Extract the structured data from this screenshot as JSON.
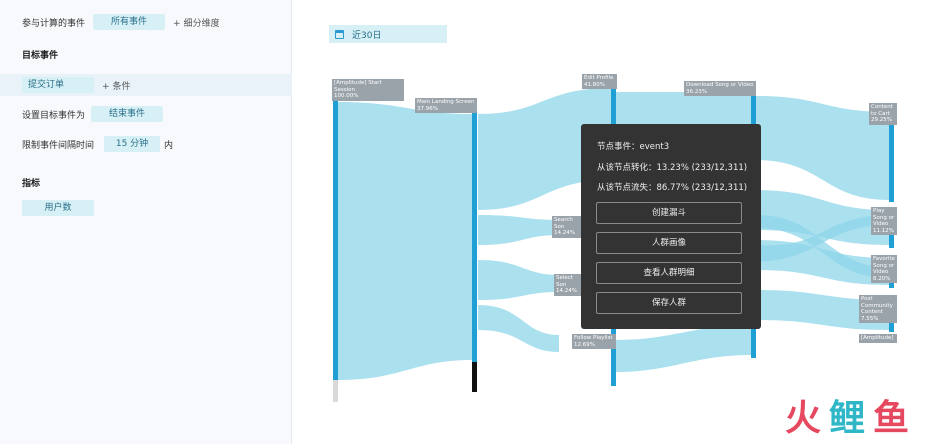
{
  "config": {
    "events_label": "参与计算的事件",
    "events_value": "所有事件",
    "add_dimension": "细分维度",
    "target_title": "目标事件",
    "target_event": "提交订单",
    "add_condition": "条件",
    "set_target_label": "设置目标事件为",
    "set_target_value": "结束事件",
    "interval_label": "限制事件间隔时间",
    "interval_value": "15 分钟",
    "interval_suffix": "内",
    "metric_title": "指标",
    "metric_value": "用户数"
  },
  "main": {
    "date_range": "近30日"
  },
  "nodes": [
    {
      "name": "[Amplitude] Start Session",
      "pct": "100.00%"
    },
    {
      "name": "Main Landing Screen",
      "pct": "37.96%"
    },
    {
      "name": "Edit Profile",
      "pct": "41.80%"
    },
    {
      "name": "Download Song or Video",
      "pct": "36.23%"
    },
    {
      "name": "Content to Cart",
      "pct": "29.25%"
    },
    {
      "name": "Search Son",
      "pct": "14.24%"
    },
    {
      "name": "Select Son",
      "pct": "14.24%"
    },
    {
      "name": "Follow Playlist",
      "pct": "12.69%"
    },
    {
      "name": "Play Song or Video",
      "pct": "11.12%"
    },
    {
      "name": "Favorite Song or Video",
      "pct": "8.20%"
    },
    {
      "name": "Post Community Content",
      "pct": "7.55%"
    },
    {
      "name": "[Amplitude]",
      "pct": ""
    }
  ],
  "tooltip": {
    "node_event": "节点事件：event3",
    "conversion": "从该节点转化：13.23% (233/12,311)",
    "churn": "从该节点流失：86.77% (233/12,311)",
    "buttons": [
      "创建漏斗",
      "人群画像",
      "查看人群明细",
      "保存人群"
    ]
  },
  "watermark": "火鲤鱼",
  "colors": {
    "flow": "#8fd6ea",
    "node_bar": "#1f9fd3",
    "chip_bg": "#d6f0f6",
    "tooltip_bg": "#333333"
  }
}
